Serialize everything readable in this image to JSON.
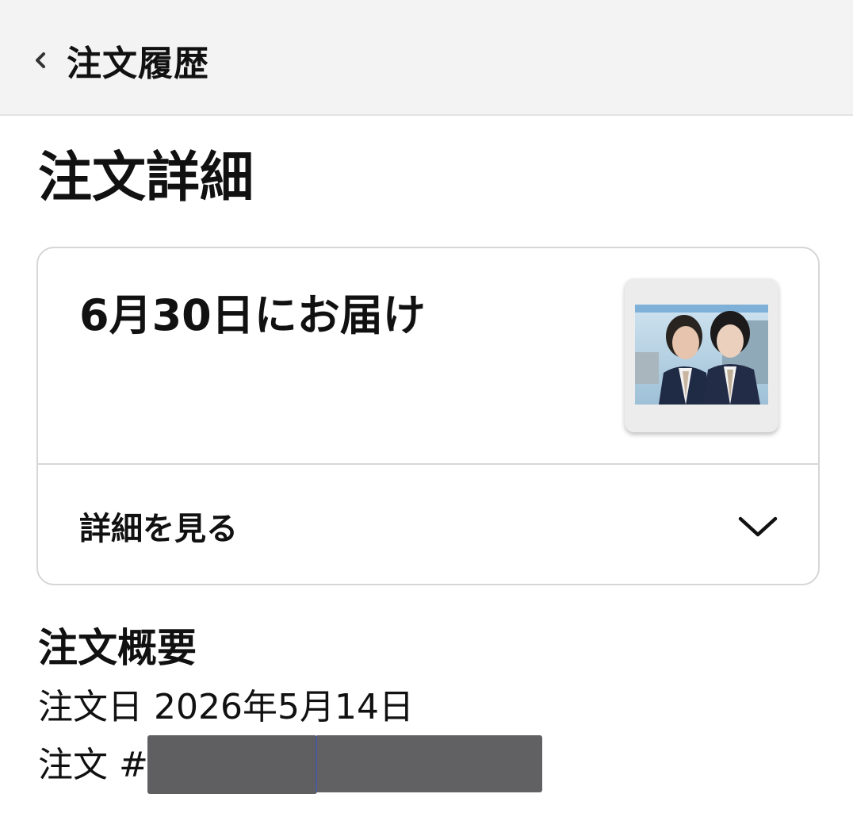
{
  "header": {
    "back_label": "注文履歴"
  },
  "page": {
    "title": "注文詳細"
  },
  "delivery_card": {
    "delivery_text": "6月30日にお届け",
    "details_label": "詳細を見る"
  },
  "summary": {
    "title": "注文概要",
    "order_date_label": "注文日",
    "order_date_value": "2026年5月14日",
    "order_number_label": "注文 #"
  },
  "icons": {
    "back": "chevron-left-icon",
    "expand": "chevron-down-icon"
  },
  "colors": {
    "header_bg": "#f3f3f3",
    "card_border": "#d6d6d6",
    "text": "#111111",
    "redaction": "#5f5f61"
  }
}
